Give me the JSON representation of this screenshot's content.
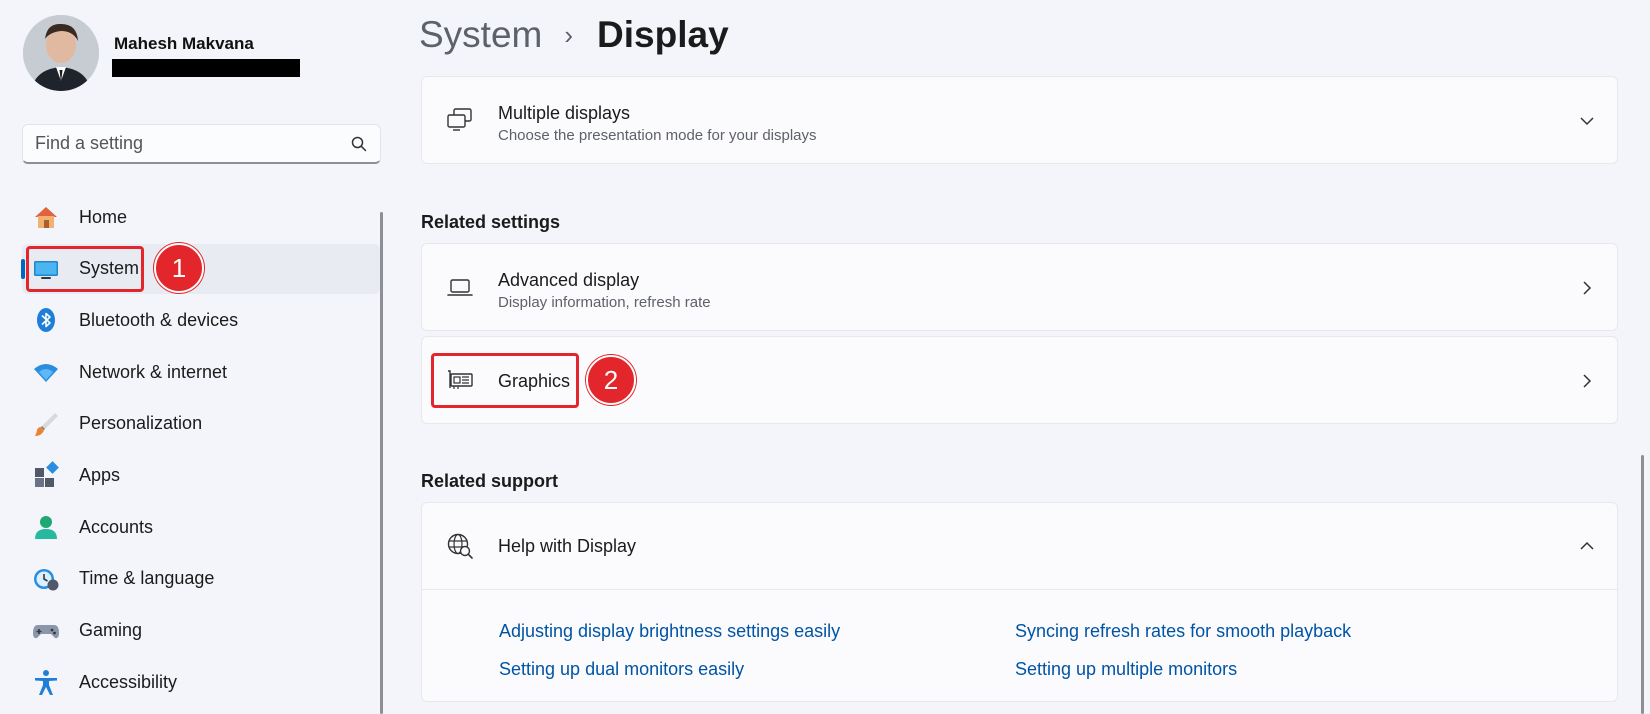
{
  "user": {
    "name": "Mahesh Makvana"
  },
  "search": {
    "placeholder": "Find a setting"
  },
  "nav": {
    "items": [
      {
        "label": "Home"
      },
      {
        "label": "System"
      },
      {
        "label": "Bluetooth & devices"
      },
      {
        "label": "Network & internet"
      },
      {
        "label": "Personalization"
      },
      {
        "label": "Apps"
      },
      {
        "label": "Accounts"
      },
      {
        "label": "Time & language"
      },
      {
        "label": "Gaming"
      },
      {
        "label": "Accessibility"
      }
    ],
    "selected": "System"
  },
  "breadcrumb": {
    "parent": "System",
    "separator": "›",
    "current": "Display"
  },
  "cards": {
    "multiple_displays": {
      "title": "Multiple displays",
      "subtitle": "Choose the presentation mode for your displays"
    },
    "advanced_display": {
      "title": "Advanced display",
      "subtitle": "Display information, refresh rate"
    },
    "graphics": {
      "title": "Graphics"
    }
  },
  "sections": {
    "related_settings": "Related settings",
    "related_support": "Related support"
  },
  "help": {
    "title": "Help with Display",
    "links": [
      "Adjusting display brightness settings easily",
      "Syncing refresh rates for smooth playback",
      "Setting up dual monitors easily",
      "Setting up multiple monitors"
    ]
  },
  "callouts": {
    "one": "1",
    "two": "2"
  },
  "colors": {
    "accent": "#0067c0",
    "callout": "#e3262b",
    "link": "#0054a6"
  }
}
